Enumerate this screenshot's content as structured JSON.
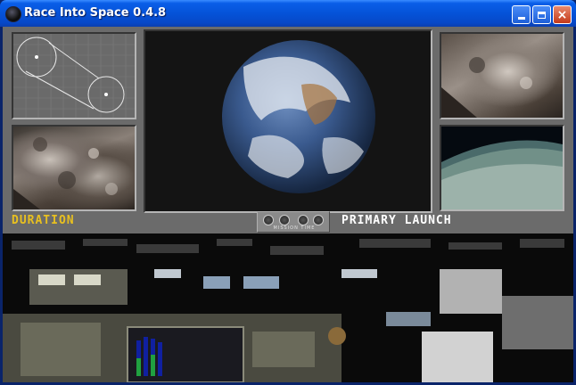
{
  "window": {
    "title": "Race Into Space 0.4.8",
    "controls": {
      "minimize": "minimize",
      "maximize": "maximize",
      "close": "×"
    }
  },
  "viewscreens": {
    "top_left": "trajectory-map",
    "bottom_left": "lunar-surface",
    "center": "earth-view",
    "top_right": "lunar-surface",
    "bottom_right": "earth-horizon"
  },
  "status": {
    "left_label": "DURATION",
    "right_label": "PRIMARY LAUNCH",
    "mission_time_label": "MISSION TIME"
  },
  "colors": {
    "duration_label": "#e8c020",
    "primary_label": "#ffffff",
    "titlebar": "#0553d8"
  }
}
